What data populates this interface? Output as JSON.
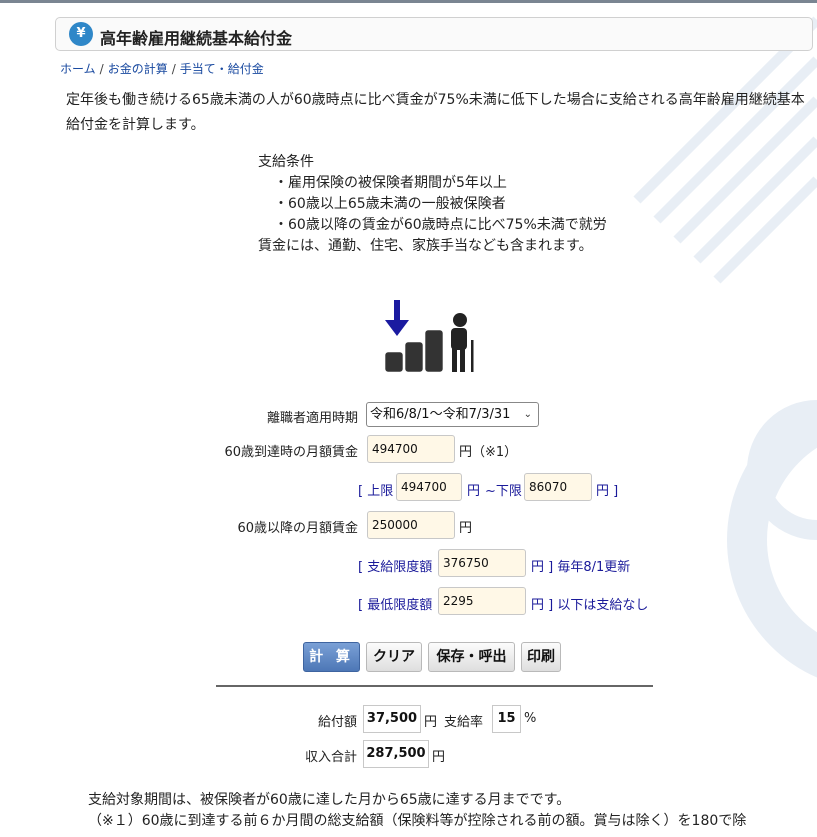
{
  "title": "高年齢雇用継続基本給付金",
  "title_icon": "money-bag-icon",
  "breadcrumb": {
    "home": "ホーム",
    "calc": "お金の計算",
    "allowance": "手当て・給付金",
    "separator": "/"
  },
  "intro": "定年後も働き続ける65歳未満の人が60歳時点に比べ賃金が75%未満に低下した場合に支給される高年齢雇用継続基本給付金を計算します。",
  "conditions": {
    "heading": "支給条件",
    "items": [
      "・雇用保険の被保険者期間が5年以上",
      "・60歳以上65歳未満の一般被保険者",
      "・60歳以降の賃金が60歳時点に比べ75%未満で就労"
    ],
    "footer": "賃金には、通勤、住宅、家族手当なども含まれます。"
  },
  "form": {
    "period_label": "離職者適用時期",
    "period_value": "令和6/8/1～令和7/3/31",
    "wage60_label": "60歳到達時の月額賃金",
    "wage60_value": "494700",
    "wage60_unit": "円（※1）",
    "upper_label": "[ 上限",
    "upper_value": "494700",
    "upper_unit": "円",
    "lower_label": "~下限",
    "lower_value": "86070",
    "lower_unit": "円 ]",
    "wage_after_label": "60歳以降の月額賃金",
    "wage_after_value": "250000",
    "wage_after_unit": "円",
    "limit_label": "[ 支給限度額",
    "limit_value": "376750",
    "limit_unit": "円 ] 毎年8/1更新",
    "min_label": "[ 最低限度額",
    "min_value": "2295",
    "min_unit": "円 ] 以下は支給なし"
  },
  "buttons": {
    "calc": "計 算",
    "clear": "クリア",
    "save": "保存・呼出",
    "print": "印刷"
  },
  "result": {
    "benefit_label": "給付額",
    "benefit_value": "37,500",
    "benefit_unit": "円",
    "rate_label": "支給率",
    "rate_value": "15",
    "rate_unit": "%",
    "income_label": "収入合計",
    "income_value": "287,500",
    "income_unit": "円"
  },
  "notes": [
    "支給対象期間は、被保険者が60歳に達した月から65歳に達する月までです。",
    "（※１）60歳に到達する前６か月間の総支給額（保険料等が控除される前の額。賞与は除く）を180で除"
  ],
  "colors": {
    "accent": "#2f87c8",
    "label_blue": "#1a1a9a",
    "input_bg": "#fff8e7",
    "primary_button": "#4d77b6"
  }
}
